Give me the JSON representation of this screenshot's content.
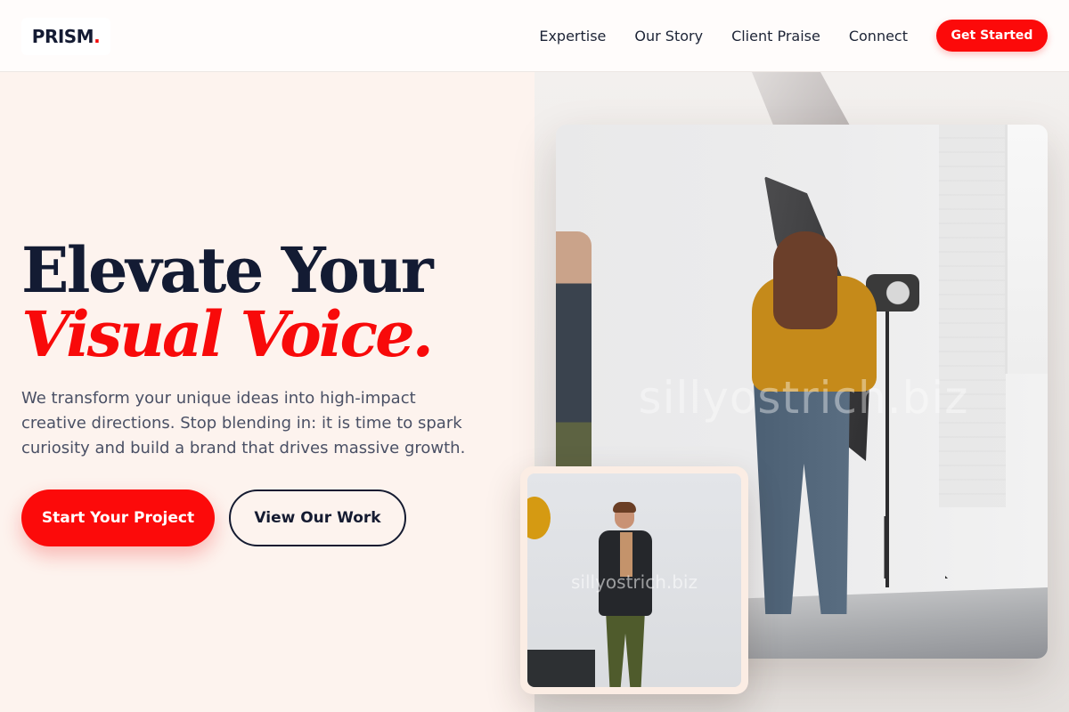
{
  "header": {
    "logo_text": "PRISM",
    "logo_dot": ".",
    "nav": [
      {
        "label": "Expertise"
      },
      {
        "label": "Our Story"
      },
      {
        "label": "Client Praise"
      },
      {
        "label": "Connect"
      }
    ],
    "cta_label": "Get Started"
  },
  "hero": {
    "title_line1": "Elevate Your",
    "title_line2": "Visual Voice.",
    "description": "We transform your unique ideas into high-impact creative directions. Stop blending in: it is time to spark curiosity and build a brand that drives massive growth.",
    "primary_button": "Start Your Project",
    "secondary_button": "View Our Work"
  },
  "images": {
    "main_watermark": "sillyostrich.biz",
    "small_watermark": "sillyostrich.biz"
  },
  "colors": {
    "accent": "#fc0a0a",
    "navy": "#131b33",
    "hero_bg": "#fdf3ee"
  }
}
